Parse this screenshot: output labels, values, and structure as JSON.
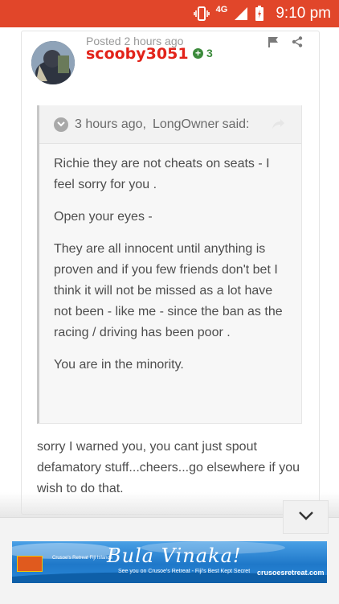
{
  "status_bar": {
    "network": "4G",
    "time": "9:10 pm"
  },
  "post": {
    "posted": "Posted 2 hours ago",
    "username": "scooby3051",
    "reputation": "3",
    "quote": {
      "header_time": "3 hours ago,",
      "author": "LongOwner",
      "said": "said:",
      "paragraphs": [
        "Richie they are not cheats on seats - I feel sorry for you .",
        "Open your eyes -",
        "They are all innocent until anything is proven and if you few friends don't bet I think it will not be missed as a lot have not been - like me - since the ban as the racing / driving has been poor .",
        "You are in the minority."
      ]
    },
    "reply": "sorry I warned you, you cant just spout defamatory stuff...cheers...go elsewhere if you wish to do that."
  },
  "ad": {
    "title": "Bula Vinaka!",
    "tagline": "See you on Crusoe's Retreat - Fiji's Best Kept Secret",
    "url": "crusoesretreat.com",
    "logo_text": "Crusoe's Retreat Fiji Islands"
  },
  "colors": {
    "status_bar": "#e1462a",
    "username": "#e2231a",
    "reputation": "#3c8b3c"
  }
}
